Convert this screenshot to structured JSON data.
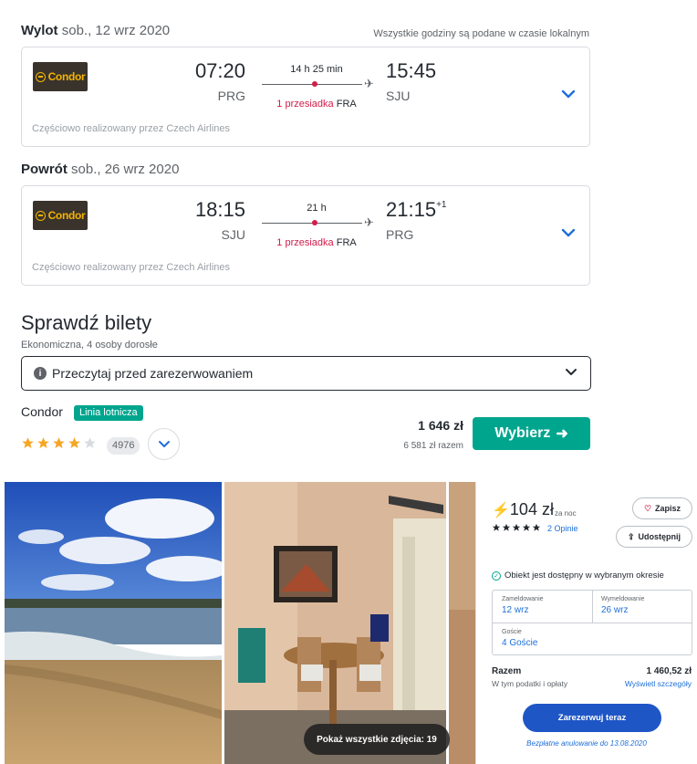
{
  "header": {
    "outbound_label": "Wylot",
    "outbound_date": "sob., 12 wrz 2020",
    "local_time_note": "Wszystkie godziny są podane w czasie lokalnym",
    "return_label": "Powrót",
    "return_date": "sob., 26 wrz 2020"
  },
  "flights": [
    {
      "airline_logo": "Condor",
      "dep_time": "07:20",
      "dep_airport": "PRG",
      "duration": "14 h 25 min",
      "stops": "1 przesiadka",
      "via": "FRA",
      "arr_time": "15:45",
      "arr_day_offset": "",
      "arr_airport": "SJU",
      "operated_by": "Częściowo realizowany przez Czech Airlines"
    },
    {
      "airline_logo": "Condor",
      "dep_time": "18:15",
      "dep_airport": "SJU",
      "duration": "21 h",
      "stops": "1 przesiadka",
      "via": "FRA",
      "arr_time": "21:15",
      "arr_day_offset": "+1",
      "arr_airport": "PRG",
      "operated_by": "Częściowo realizowany przez Czech Airlines"
    }
  ],
  "tickets": {
    "title": "Sprawdź bilety",
    "subtitle": "Ekonomiczna, 4 osoby dorosłe",
    "read_before": "Przeczytaj przed zarezerwowaniem",
    "carrier": "Condor",
    "badge": "Linia lotnicza",
    "rating_stars": 4,
    "rating_count": "4976",
    "price": "1 646 zł",
    "price_total": "6 581 zł razem",
    "select_label": "Wybierz"
  },
  "photos": {
    "show_all": "Pokaż wszystkie zdjęcia: 19"
  },
  "booking": {
    "price": "104 zł",
    "per_night": "za noc",
    "stars": 5,
    "reviews": "2 Opinie",
    "save": "Zapisz",
    "share": "Udostępnij",
    "availability": "Obiekt jest dostępny w wybranym okresie",
    "checkin_label": "Zameldowanie",
    "checkin_value": "12 wrz",
    "checkout_label": "Wymeldowanie",
    "checkout_value": "26 wrz",
    "guests_label": "Goście",
    "guests_value": "4 Goście",
    "total_label": "Razem",
    "total_value": "1 460,52 zł",
    "taxes_note": "W tym podatki i opłaty",
    "details_link": "Wyświetl szczegóły",
    "reserve": "Zarezerwuj teraz",
    "free_cancel": "Bezpłatne anulowanie do 13.08.2020"
  },
  "colors": {
    "accent_green": "#00a58e",
    "stop_red": "#d21c4a",
    "link_blue": "#1e6fd9",
    "reserve_blue": "#1f56c6"
  }
}
